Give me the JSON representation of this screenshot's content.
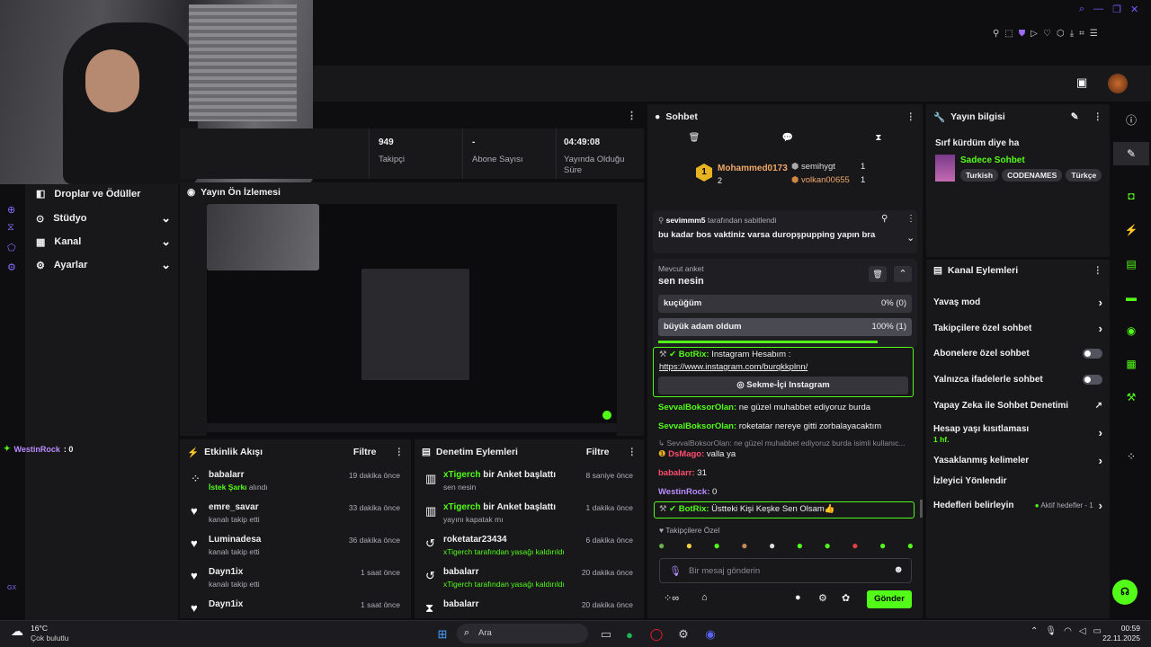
{
  "topbar": {
    "dots": "⋮"
  },
  "stats": [
    {
      "value": "949",
      "label": "Takipçi"
    },
    {
      "value": "-",
      "label": "Abone Sayısı"
    },
    {
      "value": "04:49:08",
      "label": "Yayında Olduğu Süre"
    }
  ],
  "left_nav": {
    "items": [
      {
        "label": "Droplar ve Ödüller"
      },
      {
        "label": "Stüdyo"
      },
      {
        "label": "Kanal"
      },
      {
        "label": "Ayarlar"
      }
    ],
    "status_user": "WestinRock",
    "status_val": ": 0",
    "gx": "GX"
  },
  "preview": {
    "title": "Yayın Ön İzlemesi"
  },
  "activity": {
    "title": "Etkinlik Akışı",
    "filter": "Filtre",
    "items": [
      {
        "name": "babalarr",
        "sub_green": "İstek Şarkı",
        "sub": " alındı",
        "time": "19 dakika önce"
      },
      {
        "name": "emre_savar",
        "sub_green": "",
        "sub": "kanalı takip etti",
        "time": "33 dakika önce"
      },
      {
        "name": "Luminadesa",
        "sub_green": "",
        "sub": "kanalı takip etti",
        "time": "36 dakika önce"
      },
      {
        "name": "Dayn1ix",
        "sub_green": "",
        "sub": "kanalı takip etti",
        "time": "1 saat önce"
      },
      {
        "name": "Dayn1ix",
        "sub_green": "",
        "sub": "",
        "time": "1 saat önce"
      }
    ]
  },
  "moderation": {
    "title": "Denetim Eylemleri",
    "filter": "Filtre",
    "items": [
      {
        "actor": "xTigerch",
        "action": " bir Anket başlattı",
        "sub": "sen nesin",
        "time": "8 saniye önce"
      },
      {
        "actor": "xTigerch",
        "action": " bir Anket başlattı",
        "sub": "yayını kapatak mı",
        "time": "1 dakika önce"
      },
      {
        "actor": "roketatar23434",
        "action": "",
        "sub": "xTigerch tarafından yasağı kaldırıldı",
        "time": "6 dakika önce"
      },
      {
        "actor": "babalarr",
        "action": "",
        "sub": "xTigerch tarafından yasağı kaldırıldı",
        "time": "20 dakika önce"
      },
      {
        "actor": "babalarr",
        "action": "",
        "sub": "",
        "time": "20 dakika önce"
      }
    ]
  },
  "chat": {
    "title": "Sohbet",
    "leaders": {
      "first_name": "Mohammed0173",
      "first_count": "2",
      "second_name": "semihygt",
      "second_count": "1",
      "third_name": "volkan00655",
      "third_count": "1",
      "badge": "1"
    },
    "pinned": {
      "by": "sevimmm5",
      "by_suffix": " tarafından sabitlendi",
      "text": "bu kadar bos vaktiniz varsa duropşpupping yapın bra"
    },
    "poll": {
      "label": "Mevcut anket",
      "question": "sen nesin",
      "options": [
        {
          "text": "kuçüğüm",
          "result": "0% (0)",
          "pct": 0
        },
        {
          "text": "büyük adam oldum",
          "result": "100% (1)",
          "pct": 100
        }
      ]
    },
    "bot": {
      "name": "BotRix:",
      "text": " Instagram Hesabım :",
      "link": "https://www.instagram.com/burqkkplnn/",
      "button": "Sekme-İçi Instagram"
    },
    "messages": [
      {
        "user": "SevvalBoksorOlan:",
        "text": " ne güzel muhabbet ediyoruz burda"
      },
      {
        "user": "SevvalBoksorOlan:",
        "text": " roketatar nereye gitti zorbalayacaktım"
      }
    ],
    "reply": "SevvalBoksorOlan: ne güzel muhabbet ediyoruz burda isimli kullanıc...",
    "dsmago": {
      "user": "DsMago:",
      "text": " valla ya"
    },
    "babalarr": {
      "user": "babalarr:",
      "text": " 31"
    },
    "westin": {
      "user": "WestinRock:",
      "text": " 0"
    },
    "bot2": {
      "name": "BotRix:",
      "text": " Üstteki Kişi Keşke Sen Olsam👍"
    },
    "followers_only": "Takipçilere Özel",
    "input_placeholder": "Bir mesaj gönderin",
    "send": "Gönder"
  },
  "info": {
    "title": "Yayın bilgisi",
    "stream_title": "Sırf kürdüm diye ha",
    "category": "Sadece Sohbet",
    "tags": [
      "Turkish",
      "CODENAMES",
      "Türkçe"
    ]
  },
  "channel_actions": {
    "title": "Kanal Eylemleri",
    "items": [
      {
        "label": "Yavaş mod",
        "type": "chev"
      },
      {
        "label": "Takipçilere özel sohbet",
        "type": "chev"
      },
      {
        "label": "Abonelere özel sohbet",
        "type": "toggle"
      },
      {
        "label": "Yalnızca ifadelerle sohbet",
        "type": "toggle"
      },
      {
        "label": "Yapay Zeka ile Sohbet Denetimi",
        "type": "ext"
      },
      {
        "label": "Hesap yaşı kısıtlaması",
        "type": "chev",
        "sub": "1 hf."
      },
      {
        "label": "Yasaklanmış kelimeler",
        "type": "chev"
      },
      {
        "label": "İzleyici Yönlendir",
        "type": "none"
      },
      {
        "label": "Hedefleri belirleyin",
        "type": "chev",
        "extra": "Aktif hedefler - 1"
      }
    ]
  },
  "taskbar": {
    "temp": "16°C",
    "weather": "Çok bulutlu",
    "search": "Ara",
    "time": "00:59",
    "date": "22.11.2025"
  }
}
